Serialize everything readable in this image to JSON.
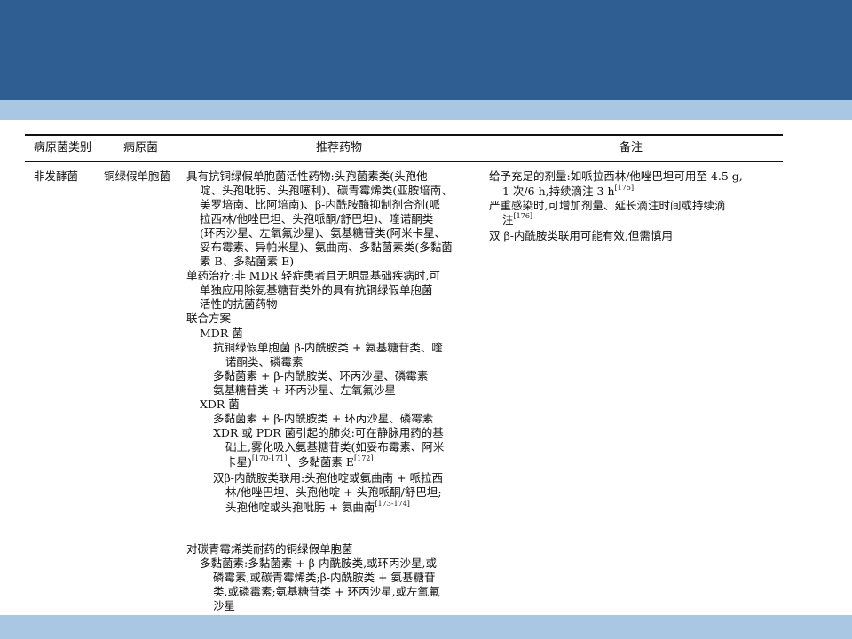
{
  "table": {
    "headers": [
      "病原菌类别",
      "病原菌",
      "推荐药物",
      "备注"
    ],
    "category": "非发酵菌",
    "pathogen": "铜绿假单胞菌",
    "drug_lines": [
      "具有抗铜绿假单胞菌活性药物:头孢菌素类(头孢他",
      "啶、头孢吡肟、头孢噻利)、碳青霉烯类(亚胺培南、",
      "美罗培南、比阿培南)、β-内酰胺酶抑制剂合剂(哌",
      "拉西林/他唑巴坦、头孢哌酮/舒巴坦)、喹诺酮类",
      "(环丙沙星、左氧氟沙星)、氨基糖苷类(阿米卡星、",
      "妥布霉素、异帕米星)、氨曲南、多黏菌素类(多黏菌",
      "素 B、多黏菌素 E)",
      "单药治疗:非 MDR 轻症患者且无明显基础疾病时,可",
      "单独应用除氨基糖苷类外的具有抗铜绿假单胞菌",
      "活性的抗菌药物",
      "联合方案",
      "MDR 菌",
      "抗铜绿假单胞菌 β-内酰胺类 + 氨基糖苷类、喹",
      "诺酮类、磷霉素",
      "多黏菌素 + β-内酰胺类、环丙沙星、磷霉素",
      "氨基糖苷类 + 环丙沙星、左氧氟沙星",
      "XDR 菌",
      "多黏菌素 + β-内酰胺类 + 环丙沙星、磷霉素",
      "XDR 或 PDR 菌引起的肺炎:可在静脉用药的基",
      "础上,雾化吸入氨基糖苷类(如妥布霉素、阿米",
      "卡星)",
      "、多黏菌素 E",
      "双β-内酰胺类联用:头孢他啶或氨曲南 + 哌拉西",
      "林/他唑巴坦、头孢他啶 + 头孢哌酮/舒巴坦;",
      "头孢他啶或头孢吡肟 + 氨曲南",
      "对碳青霉烯类耐药的铜绿假单胞菌",
      "多黏菌素:多黏菌素 + β-内酰胺类,或环丙沙星,或",
      "磷霉素,或碳青霉烯类;β-内酰胺类 + 氨基糖苷",
      "类,或磷霉素;氨基糖苷类 + 环丙沙星,或左氧氟",
      "沙星"
    ],
    "refs": {
      "r170": "[170-171]",
      "r172": "[172]",
      "r173": "[173-174]",
      "r175": "[175]",
      "r176": "[176]"
    },
    "note_lines": [
      "给予充足的剂量:如哌拉西林/他唑巴坦可用至 4.5 g,",
      "1 次/6 h,持续滴注 3 h",
      "严重感染时,可增加剂量、延长滴注时间或持续滴",
      "注",
      "双 β-内酰胺类联用可能有效,但需慎用"
    ]
  }
}
